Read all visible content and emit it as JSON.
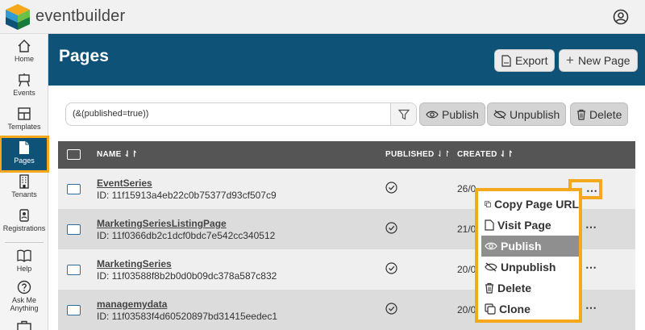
{
  "app": {
    "brand": "eventbuilder"
  },
  "sidebar": {
    "items": [
      {
        "label": "Home",
        "icon": "home-icon"
      },
      {
        "label": "Events",
        "icon": "easel-icon"
      },
      {
        "label": "Templates",
        "icon": "layout-icon"
      },
      {
        "label": "Pages",
        "icon": "page-icon",
        "active": true
      },
      {
        "label": "Tenants",
        "icon": "building-icon"
      },
      {
        "label": "Registrations",
        "icon": "badge-icon"
      },
      {
        "label": "Help",
        "icon": "book-icon"
      },
      {
        "label_line1": "Ask Me",
        "label_line2": "Anything",
        "icon": "question-icon"
      }
    ]
  },
  "header": {
    "title": "Pages",
    "export_label": "Export",
    "new_page_label": "New Page"
  },
  "filter": {
    "value": "(&(published=true))"
  },
  "actions": {
    "publish_label": "Publish",
    "unpublish_label": "Unpublish",
    "delete_label": "Delete"
  },
  "table": {
    "columns": {
      "name": "NAME",
      "published": "PUBLISHED",
      "created": "CREATED"
    },
    "rows": [
      {
        "name": "EventSeries",
        "id": "ID: 11f15913a4eb22c0b75377d93cf507c9",
        "created": "26/0",
        "published": true
      },
      {
        "name": "MarketingSeriesListingPage",
        "id": "ID: 11f0366db2c1dcf0bdc7e542cc340512",
        "created": "21/0",
        "published": true
      },
      {
        "name": "MarketingSeries",
        "id": "ID: 11f03588f8b2b0d0b09dc378a587c832",
        "created": "20/0",
        "published": true
      },
      {
        "name": "managemydata",
        "id": "ID: 11f03583f4d60520897bd31415eedec1",
        "created": "20/0",
        "published": true
      }
    ]
  },
  "context_menu": {
    "items": [
      {
        "label": "Copy Page URL",
        "icon": "copy-icon"
      },
      {
        "label": "Visit Page",
        "icon": "file-icon"
      },
      {
        "label": "Publish",
        "icon": "eye-icon",
        "highlighted": true
      },
      {
        "label": "Unpublish",
        "icon": "eye-off-icon"
      },
      {
        "label": "Delete",
        "icon": "trash-icon"
      },
      {
        "label": "Clone",
        "icon": "clone-icon"
      }
    ]
  },
  "colors": {
    "brand_blue": "#0e5277",
    "highlight_orange": "#f6a81c",
    "table_header": "#555555"
  }
}
